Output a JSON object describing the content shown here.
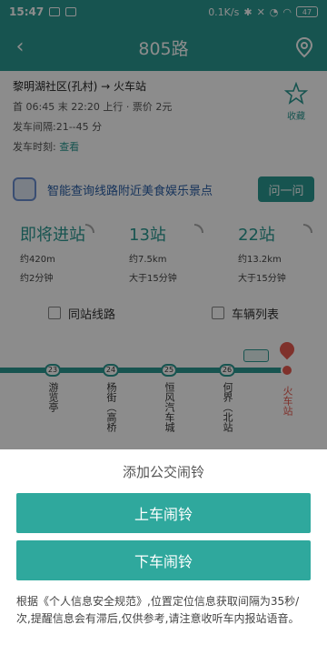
{
  "status": {
    "time": "15:47",
    "speed": "0.1K/s",
    "battery": "47"
  },
  "header": {
    "title": "805路"
  },
  "info": {
    "route": "黎明湖社区(孔村) → 火车站",
    "first_last": "首 06:45 末 22:20 上行 · 票价 2元",
    "interval": "发车间隔:21--45 分",
    "timetable_label": "发车时刻:",
    "timetable_link": "查看",
    "fav_label": "收藏"
  },
  "ai": {
    "text": "智能查询线路附近美食娱乐景点",
    "ask_label": "问一问"
  },
  "arrivals": [
    {
      "big": "即将进站",
      "dist": "约420m",
      "time": "约2分钟"
    },
    {
      "big": "13站",
      "dist": "约7.5km",
      "time": "大于15分钟"
    },
    {
      "big": "22站",
      "dist": "约13.2km",
      "time": "大于15分钟"
    }
  ],
  "tabs": {
    "same_station": "同站线路",
    "vehicles": "车辆列表"
  },
  "stations": [
    {
      "num": "23",
      "name": "游览亭"
    },
    {
      "num": "24",
      "name": "杨街（高桥"
    },
    {
      "num": "25",
      "name": "恒风汽车城"
    },
    {
      "num": "26",
      "name": "何界（北站"
    },
    {
      "num": "",
      "name": "火车站"
    }
  ],
  "sheet": {
    "title": "添加公交闹铃",
    "board_label": "上车闹铃",
    "alight_label": "下车闹铃",
    "note": "根据《个人信息安全规范》,位置定位信息获取间隔为35秒/次,提醒信息会有滞后,仅供参考,请注意收听车内报站语音。"
  },
  "colors": {
    "primary": "#2b9a93",
    "button": "#2fa89d",
    "terminal": "#e85a4f"
  }
}
